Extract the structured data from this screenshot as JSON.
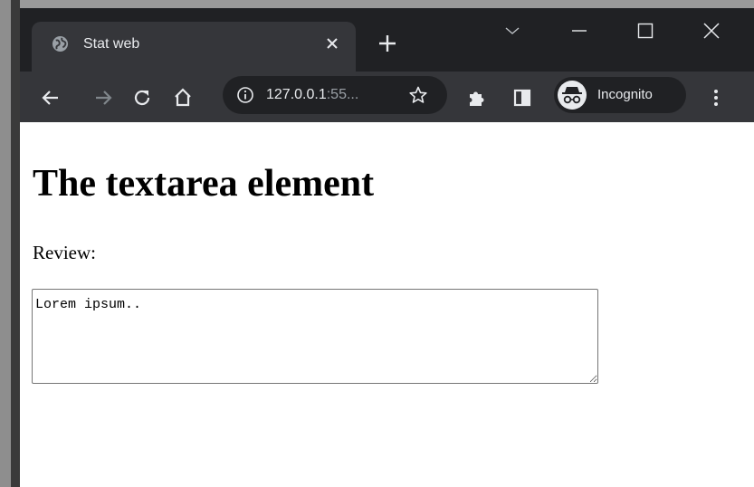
{
  "browser": {
    "tab_title": "Stat web",
    "url_host": "127.0.0.1",
    "url_rest": ":55...",
    "profile_label": "Incognito",
    "colors": {
      "titlebar": "#202124",
      "toolbar": "#35363a",
      "text": "#e8eaed",
      "dim_text": "#9aa0a6"
    },
    "icons": {
      "tab_favicon": "globe-icon",
      "tab_close": "close-icon",
      "new_tab": "plus-icon",
      "tab_search": "chevron-down-icon",
      "minimize": "minimize-icon",
      "maximize": "maximize-icon",
      "close": "close-icon",
      "back": "arrow-left-icon",
      "forward": "arrow-right-icon",
      "reload": "reload-icon",
      "home": "home-icon",
      "site_info": "info-icon",
      "bookmark": "star-icon",
      "extensions": "puzzle-icon",
      "side_panel": "side-panel-icon",
      "incognito": "incognito-icon",
      "menu": "kebab-menu-icon"
    }
  },
  "page": {
    "heading": "The textarea element",
    "label": "Review:",
    "textarea_value": "Lorem ipsum.."
  }
}
